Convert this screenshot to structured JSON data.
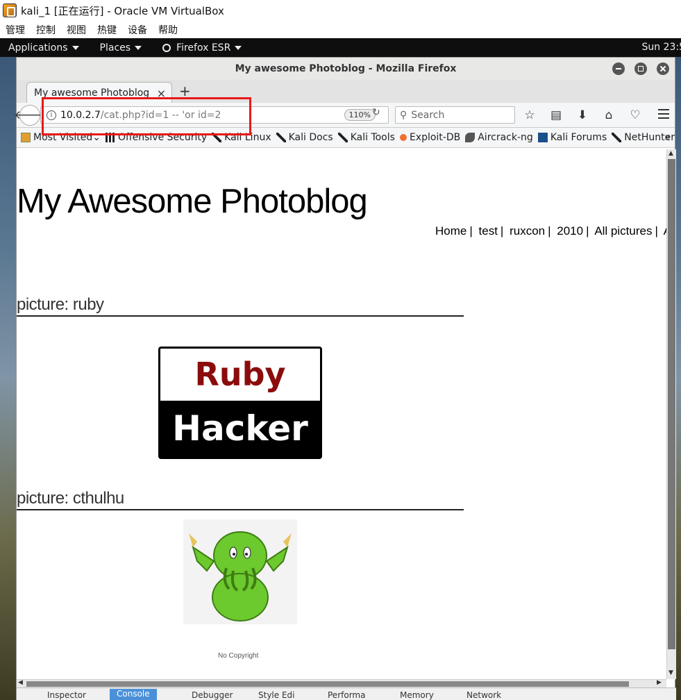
{
  "vbox": {
    "title": "kali_1 [正在运行] - Oracle VM VirtualBox",
    "menu": [
      "管理",
      "控制",
      "视图",
      "热键",
      "设备",
      "帮助"
    ]
  },
  "kali_panel": {
    "applications": "Applications",
    "places": "Places",
    "firefox": "Firefox ESR",
    "clock": "Sun 23:5"
  },
  "firefox": {
    "window_title": "My awesome Photoblog - Mozilla Firefox",
    "tab_title": "My awesome Photoblog",
    "url_host": "10.0.2.7",
    "url_path": "/cat.php?id=1 -- 'or id=2",
    "zoom": "110%",
    "search_placeholder": "Search",
    "bookmarks": [
      "Most Visited",
      "Offensive Security",
      "Kali Linux",
      "Kali Docs",
      "Kali Tools",
      "Exploit-DB",
      "Aircrack-ng",
      "Kali Forums",
      "NetHunter"
    ],
    "bookmarks_overflow": "»",
    "devtools_tabs": [
      "Inspector",
      "Console",
      "Debugger",
      "Style Edi",
      "Performa",
      "Memory",
      "Network"
    ]
  },
  "page": {
    "site_title": "My Awesome Photoblog",
    "nav": [
      "Home",
      "test",
      "ruxcon",
      "2010",
      "All pictures",
      "A"
    ],
    "nav_separator": "|",
    "pictures": [
      {
        "title": "picture: ruby",
        "image_top_text": "Ruby",
        "image_bottom_text": "Hacker"
      },
      {
        "title": "picture: cthulhu"
      }
    ],
    "footer": "No Copyright"
  }
}
